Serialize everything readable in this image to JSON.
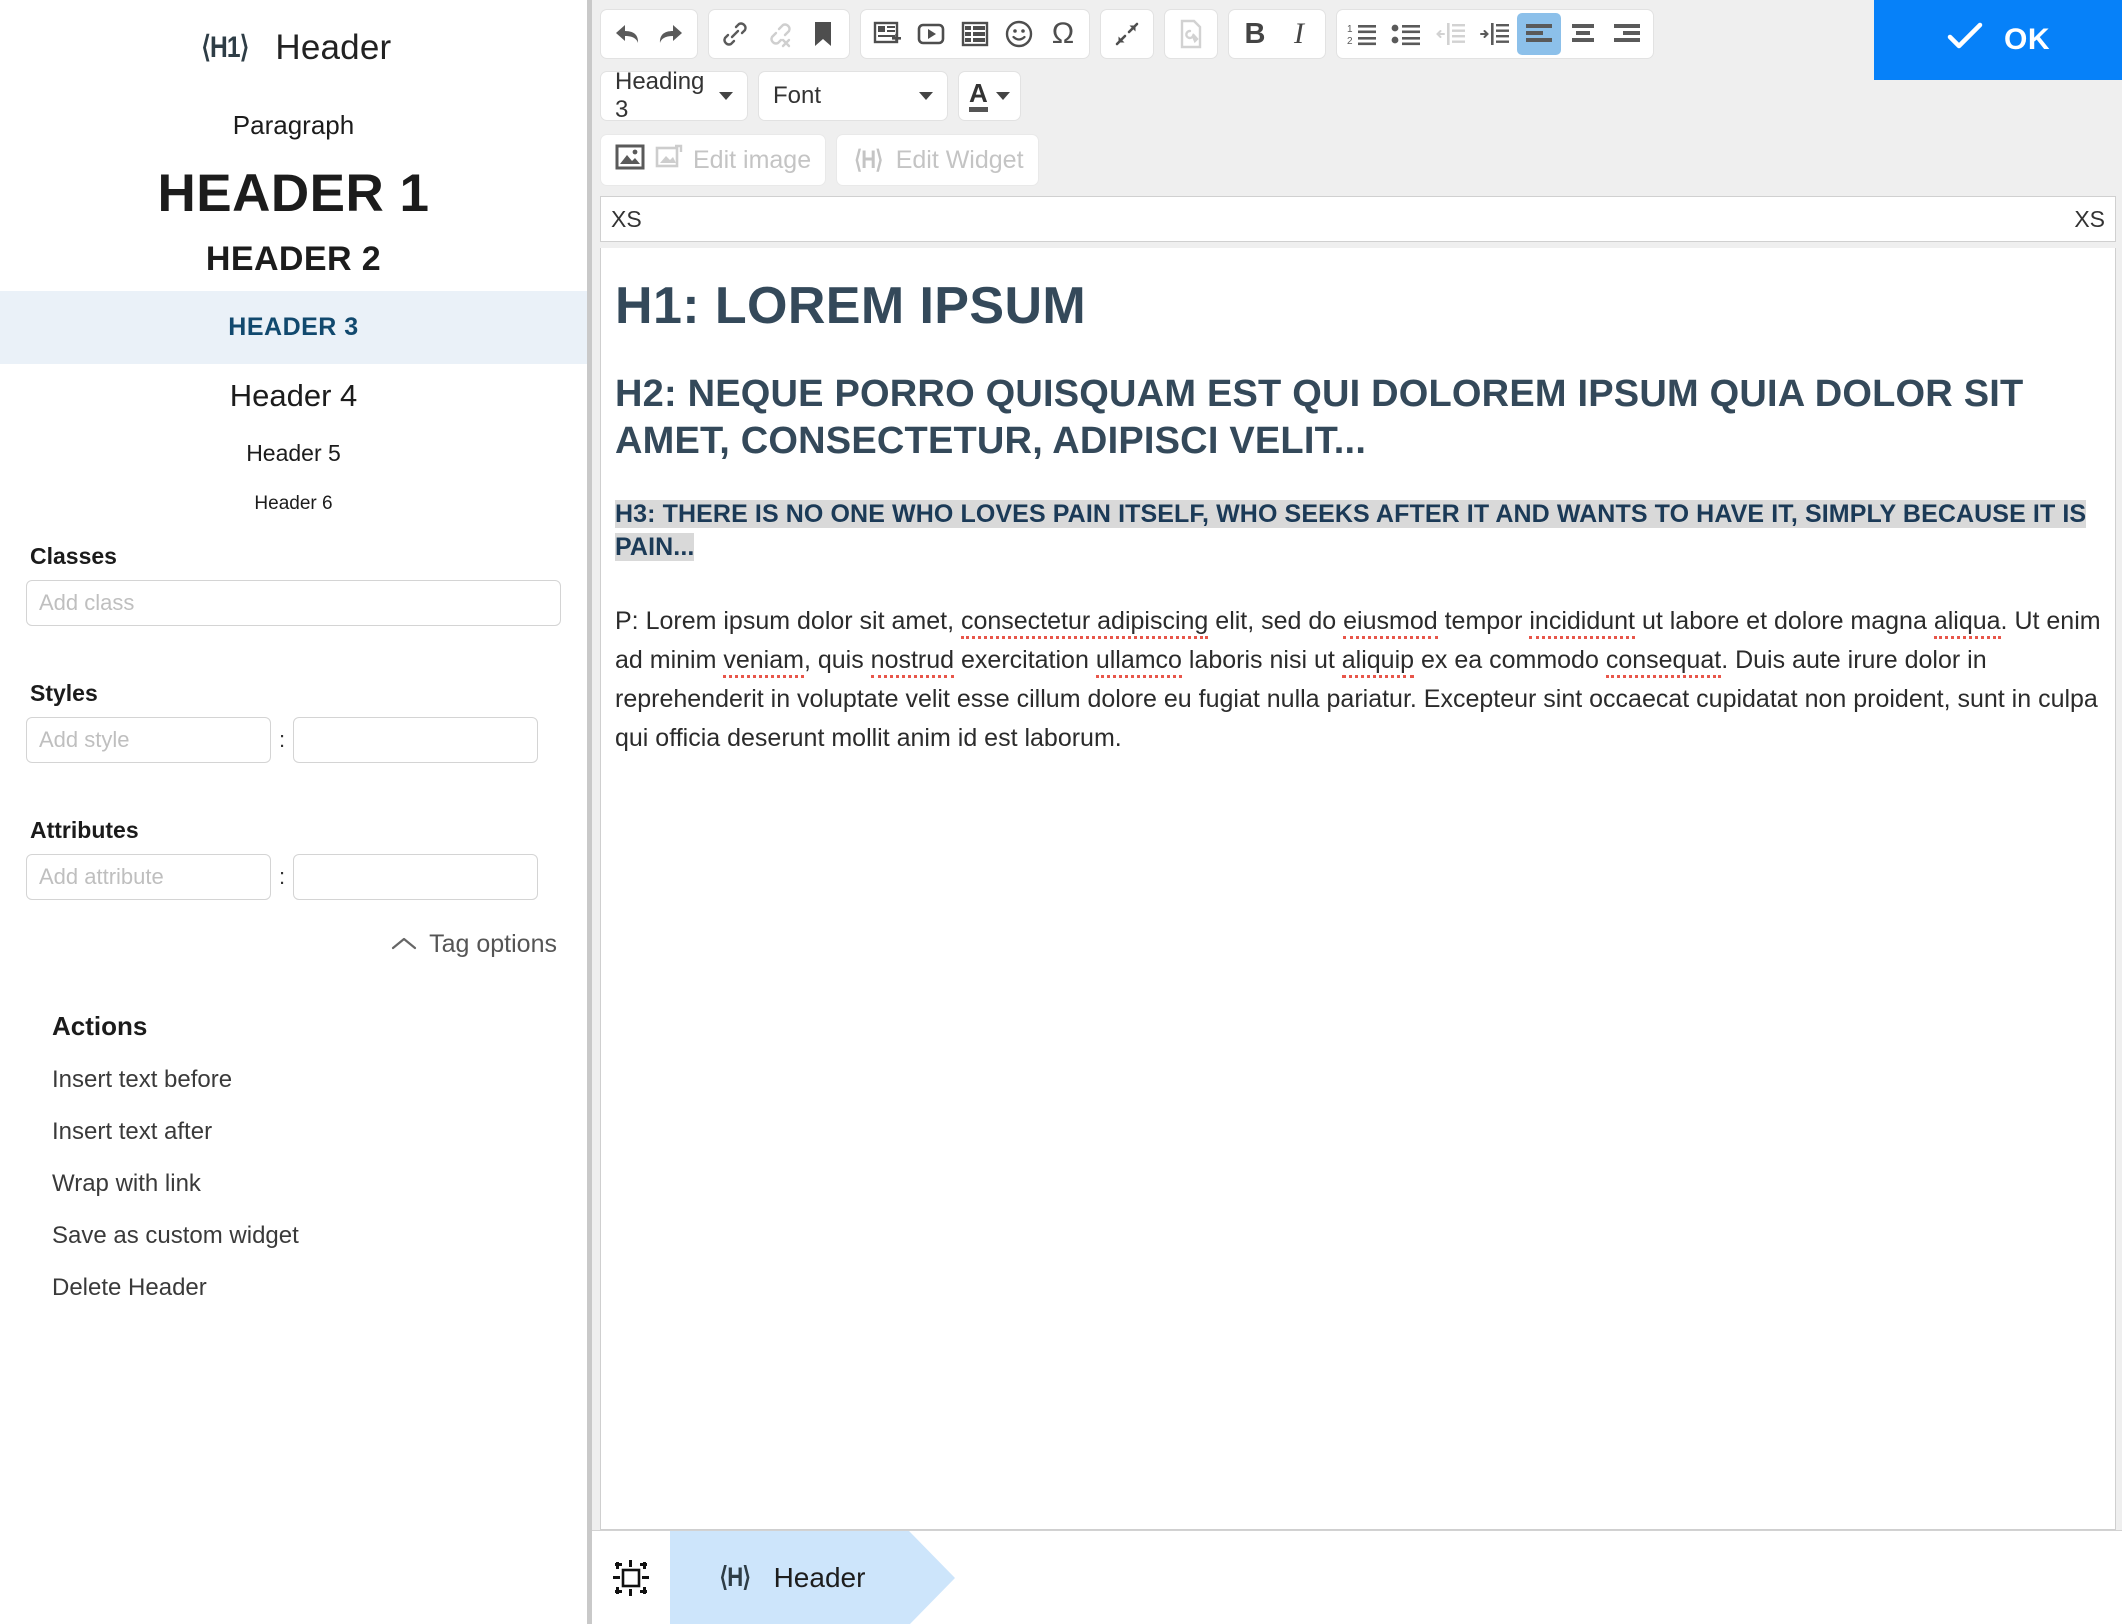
{
  "sidebar": {
    "tag_icon": "h1-tag-icon",
    "title": "Header",
    "heading_levels": [
      {
        "label": "Paragraph",
        "style": "paragraph",
        "active": false
      },
      {
        "label": "HEADER 1",
        "style": "h1",
        "active": false
      },
      {
        "label": "HEADER 2",
        "style": "h2",
        "active": false
      },
      {
        "label": "HEADER 3",
        "style": "h3",
        "active": true
      },
      {
        "label": "Header 4",
        "style": "h4",
        "active": false
      },
      {
        "label": "Header 5",
        "style": "h5",
        "active": false
      },
      {
        "label": "Header 6",
        "style": "h6",
        "active": false
      }
    ],
    "classes": {
      "label": "Classes",
      "placeholder": "Add class",
      "value": ""
    },
    "styles": {
      "label": "Styles",
      "name_placeholder": "Add style",
      "name_value": "",
      "separator": ":",
      "value_placeholder": "",
      "value_value": ""
    },
    "attributes": {
      "label": "Attributes",
      "name_placeholder": "Add attribute",
      "name_value": "",
      "separator": ":",
      "value_placeholder": "",
      "value_value": ""
    },
    "tag_options": {
      "label": "Tag options",
      "icon": "chevron-up-icon"
    },
    "actions": {
      "title": "Actions",
      "items": [
        "Insert text before",
        "Insert text after",
        "Wrap with link",
        "Save as custom widget",
        "Delete Header"
      ]
    }
  },
  "toolbar": {
    "row1": {
      "history": [
        {
          "name": "undo-icon",
          "title": "Undo",
          "disabled": false
        },
        {
          "name": "redo-icon",
          "title": "Redo",
          "disabled": false
        }
      ],
      "links": [
        {
          "name": "link-icon",
          "title": "Link",
          "disabled": false
        },
        {
          "name": "unlink-icon",
          "title": "Unlink",
          "disabled": true
        },
        {
          "name": "anchor-icon",
          "title": "Anchor",
          "disabled": false
        }
      ],
      "inserts": [
        {
          "name": "insert-template-icon",
          "title": "Templates",
          "disabled": false
        },
        {
          "name": "insert-video-icon",
          "title": "Video",
          "disabled": false
        },
        {
          "name": "insert-table-icon",
          "title": "Table",
          "disabled": false
        },
        {
          "name": "emoji-icon",
          "title": "Emoji",
          "disabled": false
        },
        {
          "name": "special-character-icon",
          "title": "Special character",
          "disabled": false
        }
      ],
      "collapse": {
        "name": "collapse-icon",
        "title": "Collapse toolbar",
        "disabled": false
      },
      "source": {
        "name": "source-tools-icon",
        "title": "Source tools",
        "disabled": true
      },
      "formatting": [
        {
          "name": "bold-icon",
          "label": "B",
          "disabled": false
        },
        {
          "name": "italic-icon",
          "label": "I",
          "disabled": false
        }
      ],
      "paragraph": [
        {
          "name": "numbered-list-icon",
          "title": "Numbered list",
          "disabled": false,
          "active": false
        },
        {
          "name": "bulleted-list-icon",
          "title": "Bulleted list",
          "disabled": false,
          "active": false
        },
        {
          "name": "outdent-icon",
          "title": "Decrease indent",
          "disabled": true,
          "active": false
        },
        {
          "name": "indent-icon",
          "title": "Increase indent",
          "disabled": false,
          "active": false
        },
        {
          "name": "align-left-icon",
          "title": "Align left",
          "disabled": false,
          "active": true
        },
        {
          "name": "align-center-icon",
          "title": "Align center",
          "disabled": false,
          "active": false
        },
        {
          "name": "align-right-icon",
          "title": "Align right",
          "disabled": false,
          "active": false
        }
      ]
    },
    "row2": {
      "paragraph_format": {
        "value": "Heading 3",
        "icon": "chevron-down-icon"
      },
      "font": {
        "value": "Font",
        "icon": "chevron-down-icon"
      },
      "text_color": {
        "icon": "text-color-icon",
        "glyph": "A",
        "caret": "chevron-down-icon"
      }
    },
    "row3": {
      "edit_image": {
        "icon": "image-icon",
        "secondary_icon": "edit-image-icon",
        "label": "Edit image",
        "disabled": true
      },
      "edit_widget": {
        "icon": "widget-icon",
        "label": "Edit Widget",
        "disabled": true
      }
    },
    "ok_button": {
      "label": "OK",
      "icon": "check-icon",
      "color": "#0681f9"
    }
  },
  "pathbar": {
    "left": "XS",
    "right": "XS"
  },
  "document": {
    "h1": "H1: LOREM IPSUM",
    "h2": "H2: NEQUE PORRO QUISQUAM EST QUI DOLOREM IPSUM QUIA DOLOR SIT AMET, CONSECTETUR, ADIPISCI VELIT...",
    "h3": "H3: THERE IS NO ONE WHO LOVES PAIN ITSELF, WHO SEEKS AFTER IT AND WANTS TO HAVE IT, SIMPLY BECAUSE IT IS PAIN...",
    "paragraph": "P: Lorem ipsum dolor sit amet, consectetur adipiscing elit, sed do eiusmod tempor incididunt ut labore et dolore magna aliqua. Ut enim ad minim veniam, quis nostrud exercitation ullamco laboris nisi ut aliquip ex ea commodo consequat. Duis aute irure dolor in reprehenderit in voluptate velit esse cillum dolore eu fugiat nulla pariatur. Excepteur sint occaecat cupidatat non proident, sunt in culpa qui officia deserunt mollit anim id est laborum."
  },
  "statusbar": {
    "select_tool": {
      "icon": "select-element-icon"
    },
    "breadcrumb": {
      "icon": "h-tag-icon",
      "label": "Header",
      "active": true,
      "color": "#cde5fb"
    }
  },
  "colors": {
    "accent": "#0681f9",
    "sidebar_active_bg": "#eaf1f8",
    "sidebar_active_fg": "#11496e",
    "selection_bg": "#d9d9d9",
    "heading_fg": "#34495a",
    "h3_fg": "#1b3a57",
    "toolbar_active": "#8cc0ea",
    "crumb_bg": "#cde5fb"
  }
}
